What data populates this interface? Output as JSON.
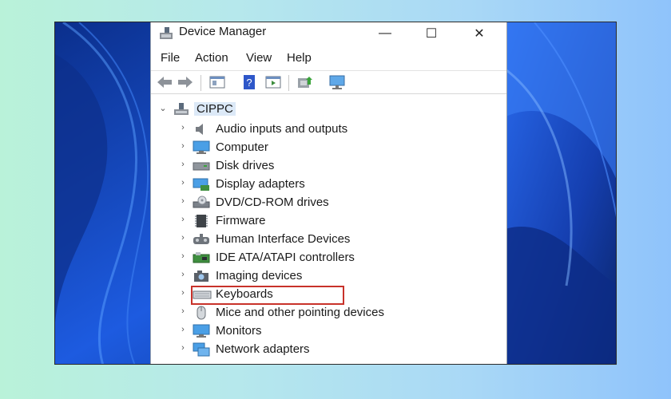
{
  "window": {
    "title": "Device Manager",
    "minimize_glyph": "—",
    "maximize_glyph": "☐",
    "close_glyph": "✕"
  },
  "menu": [
    "File",
    "Action",
    "View",
    "Help"
  ],
  "toolbar": {
    "icons": [
      "back-arrow-icon",
      "forward-arrow-icon",
      "properties-icon",
      "help-icon",
      "action-pane-icon",
      "update-driver-icon",
      "scan-hardware-icon"
    ]
  },
  "tree": {
    "root": {
      "label": "CIPPC",
      "expanded": true,
      "icon": "computer-icon"
    },
    "chevron_collapsed": "›",
    "chevron_expanded": "⌄",
    "items": [
      {
        "label": "Audio inputs and outputs",
        "icon": "speaker-icon"
      },
      {
        "label": "Computer",
        "icon": "monitor-icon"
      },
      {
        "label": "Disk drives",
        "icon": "disk-drive-icon"
      },
      {
        "label": "Display adapters",
        "icon": "display-adapter-icon"
      },
      {
        "label": "DVD/CD-ROM drives",
        "icon": "dvd-drive-icon"
      },
      {
        "label": "Firmware",
        "icon": "firmware-chip-icon"
      },
      {
        "label": "Human Interface Devices",
        "icon": "hid-icon"
      },
      {
        "label": "IDE ATA/ATAPI controllers",
        "icon": "ide-controller-icon"
      },
      {
        "label": "Imaging devices",
        "icon": "camera-icon"
      },
      {
        "label": "Keyboards",
        "icon": "keyboard-icon"
      },
      {
        "label": "Mice and other pointing devices",
        "icon": "mouse-icon"
      },
      {
        "label": "Monitors",
        "icon": "monitor-icon"
      },
      {
        "label": "Network adapters",
        "icon": "network-adapter-icon"
      }
    ]
  },
  "colors": {
    "highlight_border": "#c8322a",
    "root_selection": "#dce9f7",
    "wallpaper_blue": "#1c54d6"
  }
}
